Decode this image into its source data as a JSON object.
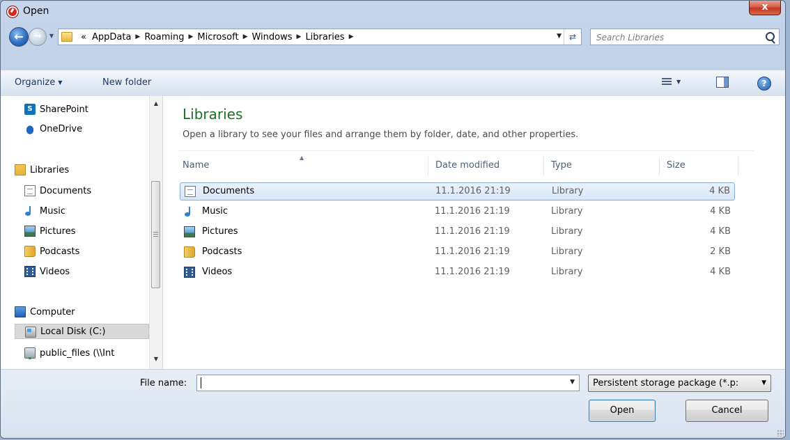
{
  "window": {
    "title": "Open",
    "close_label": "x"
  },
  "nav": {
    "breadcrumbs": [
      "«",
      "AppData",
      "Roaming",
      "Microsoft",
      "Windows",
      "Libraries"
    ],
    "search_placeholder": "Search Libraries"
  },
  "toolbar": {
    "organize_label": "Organize",
    "new_folder_label": "New folder",
    "help_label": "?"
  },
  "sidebar": {
    "items": [
      {
        "label": "SharePoint",
        "icon": "sharepoint-icon"
      },
      {
        "label": "OneDrive",
        "icon": "onedrive-icon"
      },
      {
        "label": "Libraries",
        "icon": "libraries-icon"
      },
      {
        "label": "Documents",
        "icon": "documents-icon"
      },
      {
        "label": "Music",
        "icon": "music-icon"
      },
      {
        "label": "Pictures",
        "icon": "pictures-icon"
      },
      {
        "label": "Podcasts",
        "icon": "folder-icon"
      },
      {
        "label": "Videos",
        "icon": "videos-icon"
      },
      {
        "label": "Computer",
        "icon": "computer-icon"
      },
      {
        "label": "Local Disk (C:)",
        "icon": "disk-icon",
        "selected": true
      },
      {
        "label": "public_files (\\\\Int",
        "icon": "network-drive-icon"
      }
    ]
  },
  "main": {
    "title": "Libraries",
    "subtitle": "Open a library to see your files and arrange them by folder, date, and other properties.",
    "columns": [
      "Name",
      "Date modified",
      "Type",
      "Size"
    ],
    "rows": [
      {
        "name": "Documents",
        "date": "11.1.2016 21:19",
        "type": "Library",
        "size": "4 KB",
        "selected": true
      },
      {
        "name": "Music",
        "date": "11.1.2016 21:19",
        "type": "Library",
        "size": "4 KB"
      },
      {
        "name": "Pictures",
        "date": "11.1.2016 21:19",
        "type": "Library",
        "size": "4 KB"
      },
      {
        "name": "Podcasts",
        "date": "11.1.2016 21:19",
        "type": "Library",
        "size": "2 KB"
      },
      {
        "name": "Videos",
        "date": "11.1.2016 21:19",
        "type": "Library",
        "size": "4 KB"
      }
    ]
  },
  "footer": {
    "filename_label": "File name:",
    "filename_value": "",
    "filter_value": "Persistent storage package (*.p:",
    "open_label": "Open",
    "cancel_label": "Cancel"
  },
  "colors": {
    "title_green": "#1f6e26",
    "selection_blue": "#84acdd",
    "accent_red": "#d2543f"
  }
}
